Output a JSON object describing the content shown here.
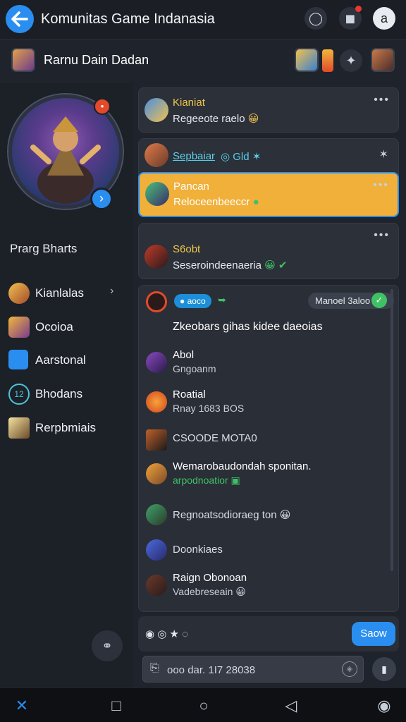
{
  "app": {
    "title": "Komunitas Game Indanasia",
    "subtitle": "Rarnu Dain Dadan"
  },
  "left_panel": {
    "heading": "Prarg Bharts",
    "nav": [
      {
        "label": "Kianlalas",
        "has_arrow": true
      },
      {
        "label": "Ocoioa"
      },
      {
        "label": "Aarstonal"
      },
      {
        "label": "Bhodans"
      },
      {
        "label": "Rerpbmiais"
      }
    ]
  },
  "cards": [
    {
      "name": "Kianiat",
      "message": "Regeeote raelo",
      "emoji": "😀"
    },
    {
      "name": "Sepbaiar",
      "name_extra": "◎ Gld ✶",
      "message": ""
    },
    {
      "name": "Pancan",
      "message": "Reloceenbeeccr",
      "emoji": "●",
      "highlighted": true
    },
    {
      "name": "S6obt",
      "message": "Seseroindeenaeria",
      "emoji": "😀 ✔"
    }
  ],
  "chat": {
    "chip_left": "aoco",
    "chip_right": "Manoel 3aloo",
    "headline": "Zkeobars gihas kidee daeoias",
    "messages": [
      {
        "name": "Abol",
        "text": "Gngoanm"
      },
      {
        "name": "Roatial",
        "text": "Rnay 1683 BOS"
      },
      {
        "name": "CSOODE MOTA0",
        "text": ""
      },
      {
        "name": "Wemarobaudondah sponitan.",
        "text": "arpodnoatior ▣",
        "text_color": "#3fc265"
      },
      {
        "name": "Regnoatsodioraeg ton 😀",
        "text": ""
      },
      {
        "name": "Doonkiaes",
        "text": ""
      },
      {
        "name": "Raign Obonoan",
        "text": "Vadebreseain 😀"
      }
    ]
  },
  "composer": {
    "reactions": "◉ ◎ ★ ◌",
    "send_label": "Saow",
    "input_value": "ooo dar. 1I7 28038"
  },
  "colors": {
    "accent": "#2a8ef0",
    "highlight": "#f0b03a",
    "name_gold": "#f0c64a",
    "bg": "#1f232b"
  }
}
